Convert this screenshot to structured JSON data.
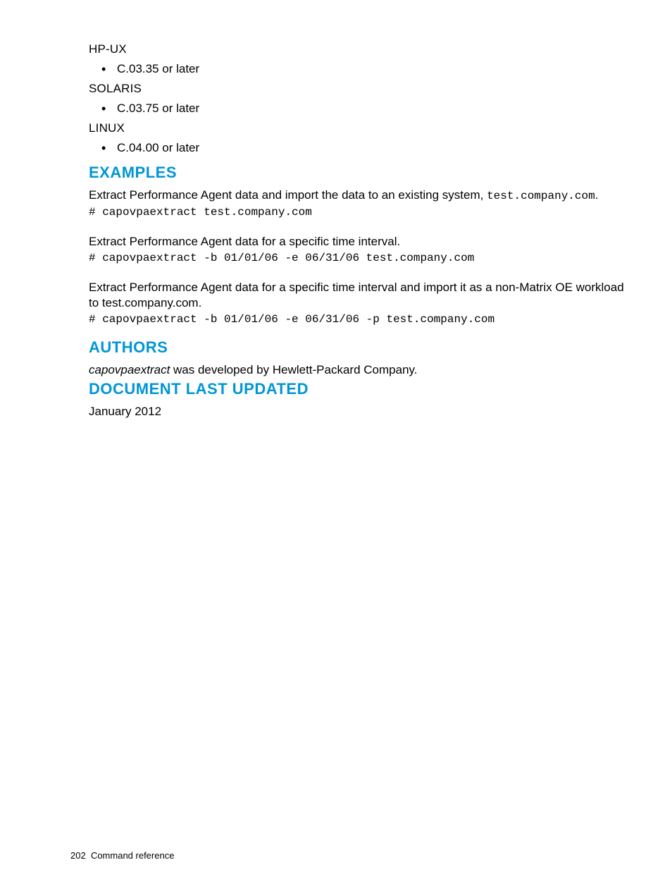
{
  "versions": {
    "os1_label": "HP-UX",
    "os1_item": "C.03.35 or later",
    "os2_label": "SOLARIS",
    "os2_item": "C.03.75 or later",
    "os3_label": "LINUX",
    "os3_item": "C.04.00 or later"
  },
  "examples": {
    "heading": "EXAMPLES",
    "p1_pre": "Extract Performance Agent data and import the data to an existing system, ",
    "p1_mono": "test.company.com",
    "p1_post": ".",
    "cmd1": "# capovpaextract test.company.com",
    "p2": "Extract Performance Agent data for a specific time interval.",
    "cmd2": "# capovpaextract -b 01/01/06 -e 06/31/06 test.company.com",
    "p3": "Extract Performance Agent data for a specific time interval and import it as a non-Matrix OE workload to test.company.com.",
    "cmd3": "# capovpaextract -b 01/01/06 -e 06/31/06 -p test.company.com"
  },
  "authors": {
    "heading": "AUTHORS",
    "cmd_name": "capovpaextract",
    "rest": " was developed by Hewlett-Packard Company."
  },
  "updated": {
    "heading": "DOCUMENT LAST UPDATED",
    "value": "January 2012"
  },
  "footer": {
    "page_no": "202",
    "title": "Command reference"
  }
}
